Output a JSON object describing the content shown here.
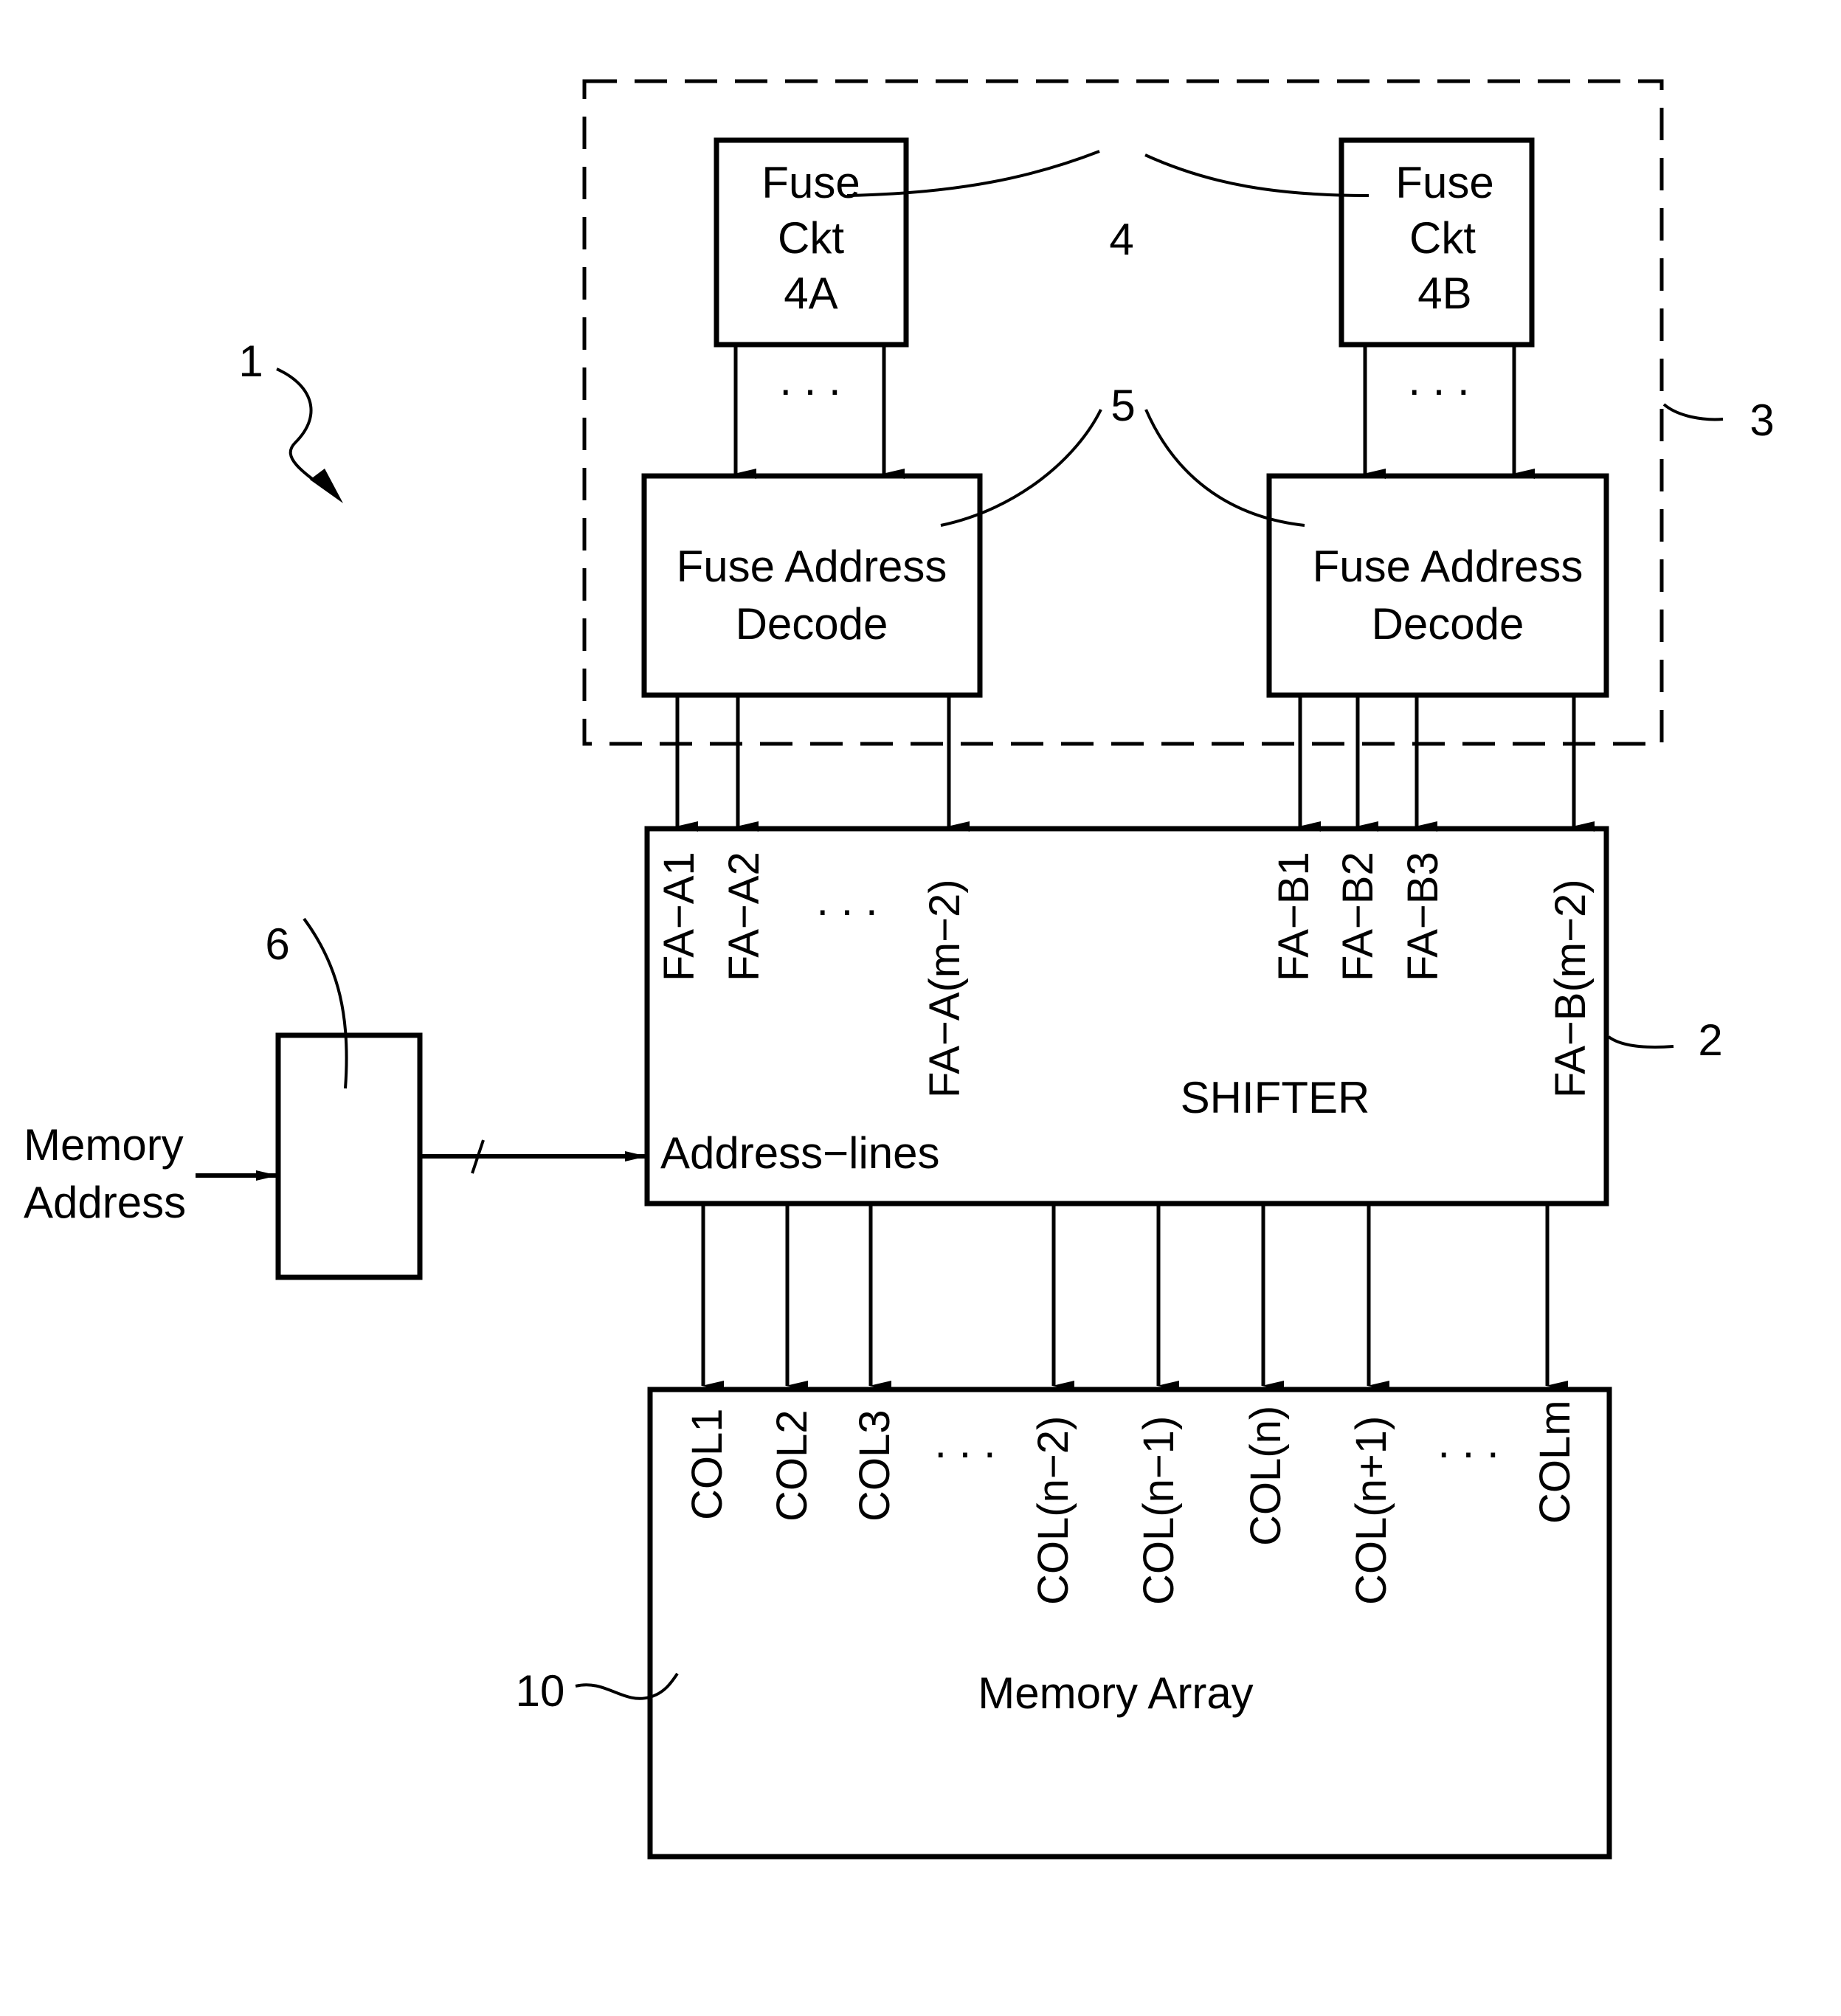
{
  "diagram": {
    "ref_overall": "1",
    "ref_shifter": "2",
    "ref_dashed_group": "3",
    "ref_fuse_ckts": "4",
    "ref_decoders": "5",
    "ref_latch": "6",
    "ref_memory_array": "10",
    "fuse_ckt_a": {
      "line1": "Fuse",
      "line2": "Ckt",
      "line3": "4A"
    },
    "fuse_ckt_b": {
      "line1": "Fuse",
      "line2": "Ckt",
      "line3": "4B"
    },
    "decoder_a": {
      "line1": "Fuse Address",
      "line2": "Decode"
    },
    "decoder_b": {
      "line1": "Fuse Address",
      "line2": "Decode"
    },
    "shifter": {
      "title": "SHIFTER",
      "address_lines": "Address−lines",
      "inputs": [
        "FA−A1",
        "FA−A2",
        "FA−A(m−2)",
        "FA−B1",
        "FA−B2",
        "FA−B3",
        "FA−B(m−2)"
      ]
    },
    "memory_address": {
      "line1": "Memory",
      "line2": "Address"
    },
    "memory_array": {
      "title": "Memory Array",
      "columns": [
        "COL1",
        "COL2",
        "COL3",
        "COL(n−2)",
        "COL(n−1)",
        "COL(n)",
        "COL(n+1)",
        "COLm"
      ]
    },
    "ellipsis": ". . ."
  }
}
